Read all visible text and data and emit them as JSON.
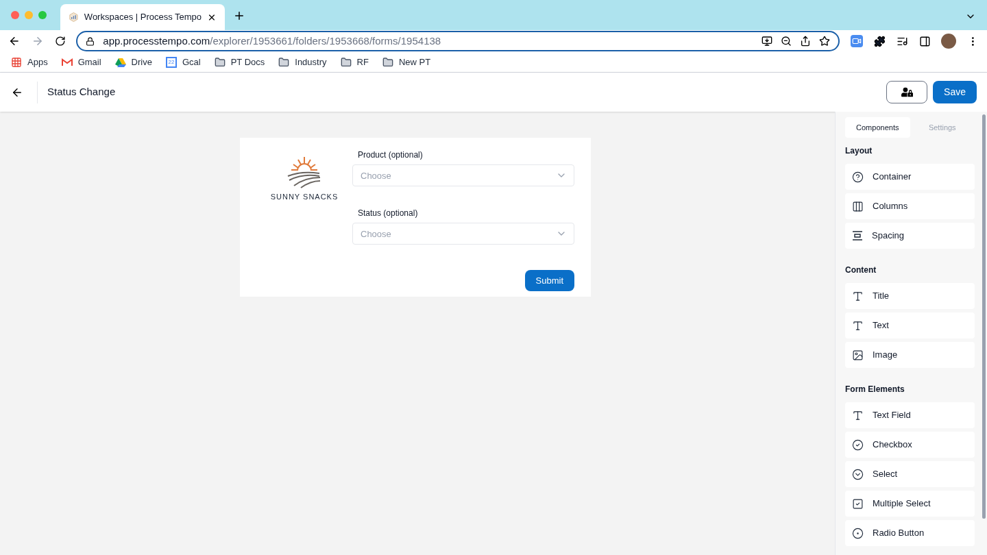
{
  "browser": {
    "tab": {
      "title": "Workspaces | Process Tempo",
      "selected": true
    },
    "url": {
      "host": "app.processtempo.com",
      "path": "/explorer/1953661/folders/1953668/forms/1954138"
    },
    "bookmarks": [
      {
        "label": "Apps",
        "kind": "apps"
      },
      {
        "label": "Gmail",
        "kind": "gmail"
      },
      {
        "label": "Drive",
        "kind": "drive"
      },
      {
        "label": "Gcal",
        "kind": "gcal",
        "badge": "22"
      },
      {
        "label": "PT Docs",
        "kind": "folder"
      },
      {
        "label": "Industry",
        "kind": "folder"
      },
      {
        "label": "RF",
        "kind": "folder"
      },
      {
        "label": "New PT",
        "kind": "folder"
      }
    ]
  },
  "header": {
    "title": "Status Change",
    "save": "Save"
  },
  "form": {
    "logo": "SUNNY SNACKS",
    "fields": [
      {
        "label": "Product (optional)",
        "placeholder": "Choose"
      },
      {
        "label": "Status (optional)",
        "placeholder": "Choose"
      }
    ],
    "submit": "Submit"
  },
  "panel": {
    "tabs": [
      {
        "label": "Components",
        "selected": true
      },
      {
        "label": "Settings",
        "selected": false
      }
    ],
    "sections": [
      {
        "title": "Layout",
        "items": [
          {
            "label": "Container",
            "kind": "help"
          },
          {
            "label": "Columns",
            "kind": "columns"
          },
          {
            "label": "Spacing",
            "kind": "spacing"
          }
        ]
      },
      {
        "title": "Content",
        "items": [
          {
            "label": "Title",
            "kind": "type"
          },
          {
            "label": "Text",
            "kind": "type"
          },
          {
            "label": "Image",
            "kind": "image"
          }
        ]
      },
      {
        "title": "Form Elements",
        "items": [
          {
            "label": "Text Field",
            "kind": "type"
          },
          {
            "label": "Checkbox",
            "kind": "check"
          },
          {
            "label": "Select",
            "kind": "chevron"
          },
          {
            "label": "Multiple Select",
            "kind": "squarecheck"
          },
          {
            "label": "Radio Button",
            "kind": "radio"
          }
        ]
      }
    ]
  }
}
